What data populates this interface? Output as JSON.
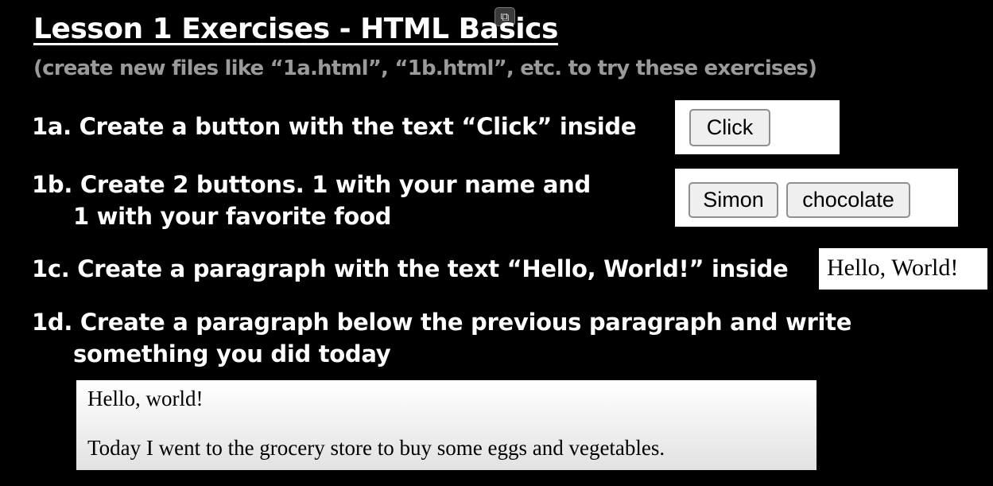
{
  "slide": {
    "title": "Lesson 1  Exercises - HTML Basics",
    "subtitle": "(create new files like “1a.html”, “1b.html”, etc. to try these exercises)"
  },
  "icon": "exit-fullscreen-icon",
  "icon_glyph": "⧉",
  "exercises": {
    "ex1a": {
      "text": "1a. Create a button with the text “Click” inside",
      "demo": {
        "button_label": "Click"
      }
    },
    "ex1b": {
      "line1": "1b. Create 2 buttons. 1 with your name and",
      "line2": "1 with your favorite food",
      "demo": {
        "name_button_label": "Simon",
        "food_button_label": "chocolate"
      }
    },
    "ex1c": {
      "text": "1c. Create a paragraph with the text “Hello, World!” inside",
      "demo": {
        "paragraph": "Hello, World!"
      }
    },
    "ex1d": {
      "line1": "1d. Create a paragraph below the previous paragraph and write",
      "line2": "something you did today",
      "demo": {
        "paragraph1": "Hello, world!",
        "paragraph2": "Today I went to the grocery store to buy some eggs and vegetables."
      }
    }
  }
}
